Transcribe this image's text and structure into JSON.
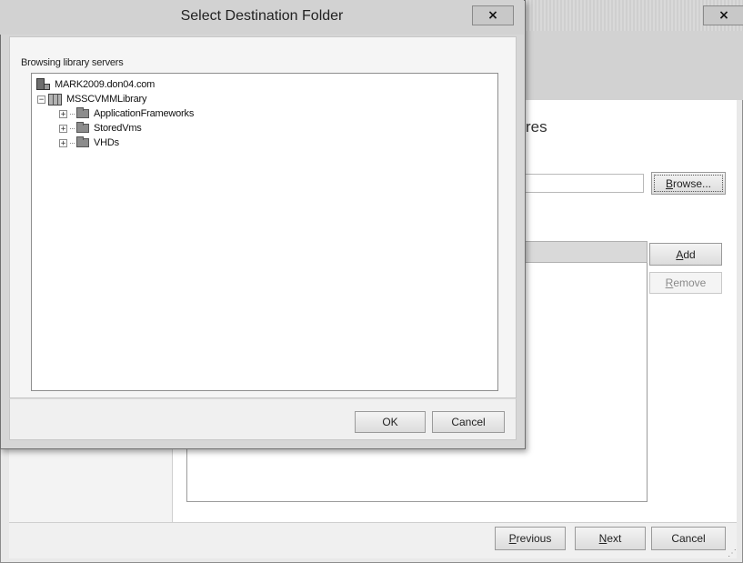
{
  "background_window": {
    "close_glyph": "×",
    "step_title_fragment": "res",
    "path_input_value": "",
    "browse_label": "Browse...",
    "add_label": "Add",
    "remove_label": "Remove",
    "footer": {
      "previous_label": "Previous",
      "next_label": "Next",
      "cancel_label": "Cancel"
    },
    "grip_glyph": "⋰"
  },
  "dialog": {
    "title": "Select Destination Folder",
    "close_glyph": "×",
    "label": "Browsing library servers",
    "tree": {
      "server": "MARK2009.don04.com",
      "library": "MSSCVMMLibrary",
      "folders": [
        {
          "label": "ApplicationFrameworks"
        },
        {
          "label": "StoredVms"
        },
        {
          "label": "VHDs"
        }
      ],
      "collapsed_glyph": "+",
      "expanded_glyph": "−"
    },
    "ok_label": "OK",
    "cancel_label": "Cancel"
  },
  "colors": {
    "titlebar": "#d2d2d2",
    "dialog_body": "#f5f5f5",
    "border": "#8e8e8e"
  }
}
